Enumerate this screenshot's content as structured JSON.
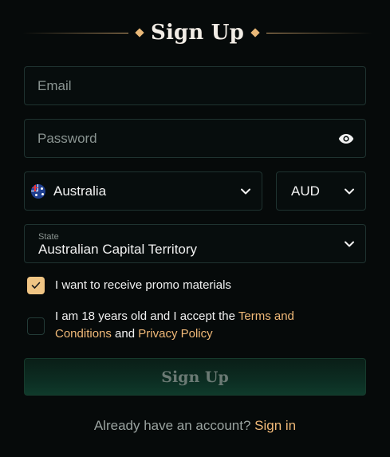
{
  "header": {
    "title": "Sign Up"
  },
  "form": {
    "email": {
      "placeholder": "Email",
      "value": ""
    },
    "password": {
      "placeholder": "Password",
      "value": "",
      "toggle_icon": "eye-icon"
    },
    "country": {
      "value": "Australia",
      "flag_icon": "australia-flag-icon"
    },
    "currency": {
      "value": "AUD"
    },
    "state": {
      "label": "State",
      "value": "Australian Capital Territory"
    },
    "promo": {
      "checked": true,
      "label": "I want to receive promo materials"
    },
    "terms": {
      "checked": false,
      "text_before": "I am 18 years old and I accept the ",
      "terms_link": "Terms and Conditions",
      "text_middle": " and ",
      "privacy_link": "Privacy Policy"
    },
    "submit_label": "Sign Up"
  },
  "footer": {
    "prompt": "Already have an account?",
    "signin_link": "Sign in"
  },
  "colors": {
    "background": "#060a0a",
    "accent": "#f0b978",
    "field_border": "#1f3330",
    "button_bg": "#0c2d22"
  }
}
